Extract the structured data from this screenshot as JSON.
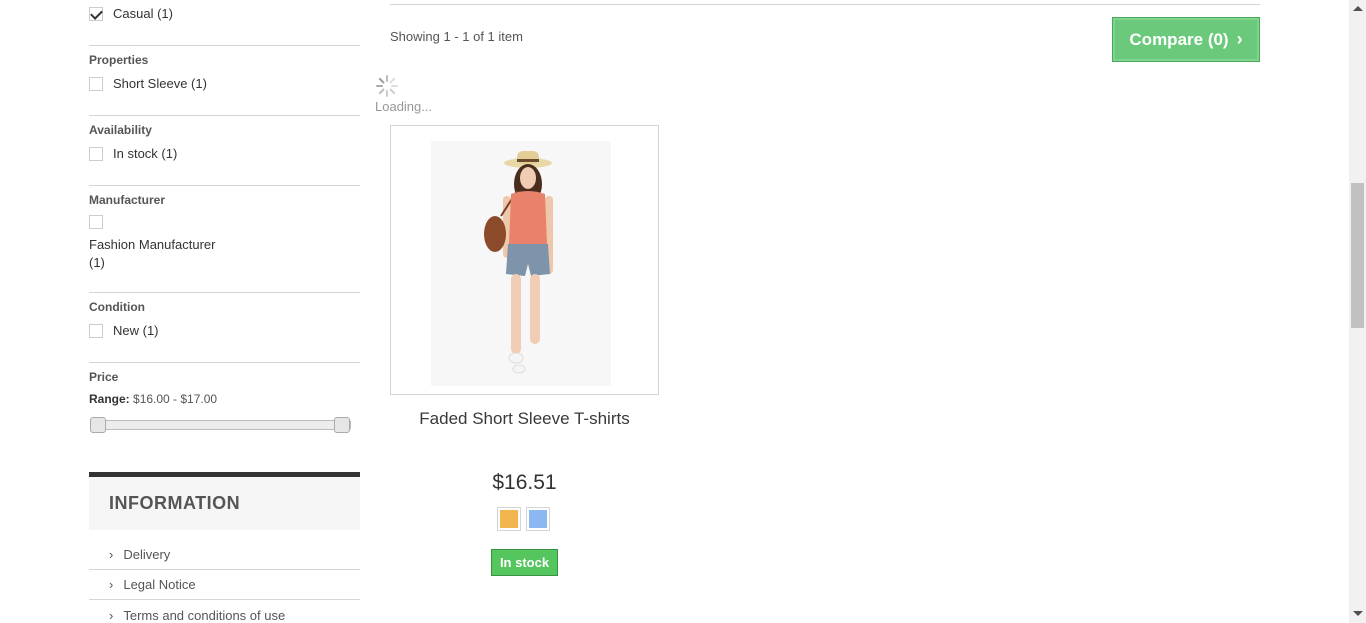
{
  "filters": {
    "category": {
      "label": "Casual (1)",
      "checked": true
    },
    "properties": {
      "title": "Properties",
      "items": [
        {
          "label": "Short Sleeve (1)"
        }
      ]
    },
    "availability": {
      "title": "Availability",
      "items": [
        {
          "label": "In stock (1)"
        }
      ]
    },
    "manufacturer": {
      "title": "Manufacturer",
      "items": [
        {
          "label_line1": "Fashion Manufacturer",
          "label_line2": "(1)"
        }
      ]
    },
    "condition": {
      "title": "Condition",
      "items": [
        {
          "label": "New (1)"
        }
      ]
    },
    "price": {
      "title": "Price",
      "range_label": "Range:",
      "range_value": "$16.00 - $17.00"
    }
  },
  "information": {
    "title": "INFORMATION",
    "links": [
      {
        "label": "Delivery"
      },
      {
        "label": "Legal Notice"
      },
      {
        "label": "Terms and conditions of use"
      }
    ]
  },
  "listing": {
    "showing": "Showing 1 - 1 of 1 item",
    "compare_label": "Compare (0)",
    "loading": "Loading..."
  },
  "product": {
    "name": "Faded Short Sleeve T-shirts",
    "price": "$16.51",
    "stock": "In stock",
    "swatches": [
      {
        "name": "orange",
        "color": "#f3b64e"
      },
      {
        "name": "blue",
        "color": "#8bb8f0"
      }
    ]
  }
}
